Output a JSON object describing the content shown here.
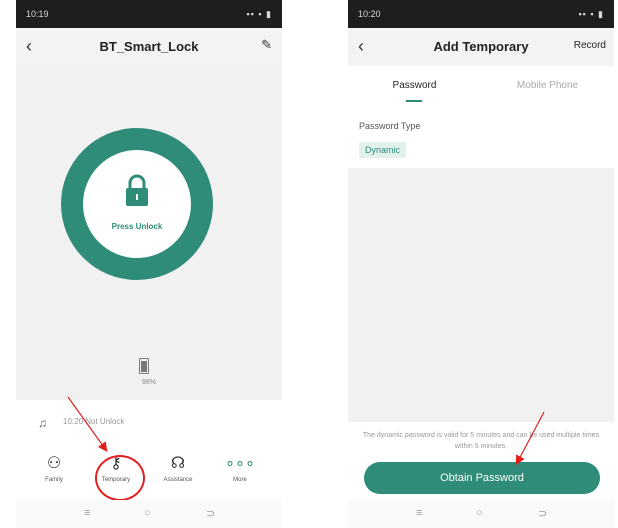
{
  "left": {
    "status": {
      "time": "10:19",
      "icons": "▪▪ ▪ ▮"
    },
    "title": "BT_Smart_Lock",
    "back_glyph": "‹",
    "edit_glyph": "✎",
    "unlock_label": "Press Unlock",
    "battery_text": "98%",
    "record_text": "10:20 Not Unlock",
    "functions": [
      {
        "label": "Family",
        "icon": "family-icon"
      },
      {
        "label": "Temporary",
        "icon": "key-icon"
      },
      {
        "label": "Assistance",
        "icon": "assistance-icon"
      },
      {
        "label": "More",
        "icon": "more-icon"
      }
    ],
    "nav": [
      "≡",
      "○",
      "⊃"
    ]
  },
  "right": {
    "status": {
      "time": "10:20",
      "icons": "▪▪ ▪ ▮"
    },
    "title": "Add Temporary",
    "back_glyph": "‹",
    "record_label": "Record",
    "tabs": [
      "Password",
      "Mobile Phone"
    ],
    "password_type_label": "Password Type",
    "password_type_value": "Dynamic",
    "note": "The dynamic password is valid for 5 minutes and can be used multiple times within 5 minutes.",
    "button_label": "Obtain Password",
    "nav": [
      "≡",
      "○",
      "⊃"
    ]
  },
  "colors": {
    "primary": "#2e8c78",
    "annotation": "#e02020"
  }
}
